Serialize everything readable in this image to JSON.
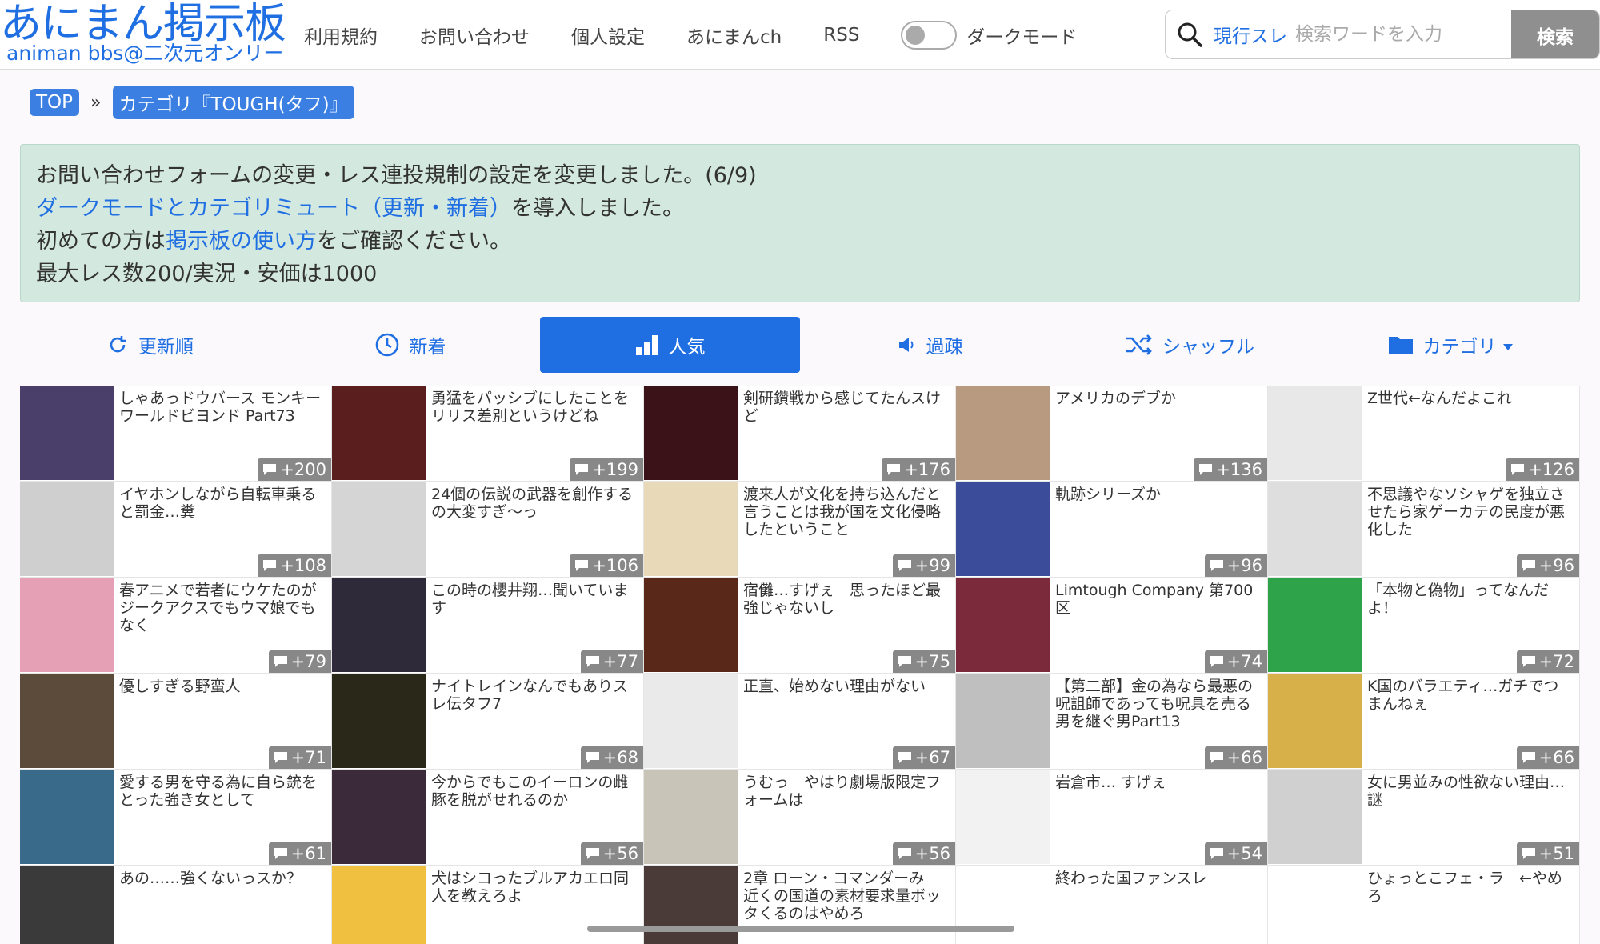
{
  "site": {
    "logo_main": "あにまん掲示板",
    "logo_sub": "animan bbs@二次元オンリー"
  },
  "nav": [
    "利用規約",
    "お問い合わせ",
    "個人設定",
    "あにまんch",
    "RSS"
  ],
  "dark_mode_label": "ダークモード",
  "search": {
    "scope": "現行スレ",
    "placeholder": "検索ワードを入力",
    "button": "検索"
  },
  "breadcrumb": {
    "top": "TOP",
    "sep": "»",
    "category": "カテゴリ『TOUGH(タフ)』"
  },
  "notice": {
    "line1": "お問い合わせフォームの変更・レス連投規制の設定を変更しました。(6/9)",
    "line2_link": "ダークモードとカテゴリミュート（更新・新着）",
    "line2_rest": "を導入しました。",
    "line3_pre": "初めての方は",
    "line3_link": "掲示板の使い方",
    "line3_post": "をご確認ください。",
    "line4": "最大レス数200/実況・安価は1000"
  },
  "tabs": [
    {
      "label": "更新順",
      "icon": "refresh-icon"
    },
    {
      "label": "新着",
      "icon": "clock-icon"
    },
    {
      "label": "人気",
      "icon": "bar-chart-icon",
      "active": true
    },
    {
      "label": "過疎",
      "icon": "speaker-icon"
    },
    {
      "label": "シャッフル",
      "icon": "shuffle-icon"
    },
    {
      "label": "カテゴリ",
      "icon": "folder-icon"
    }
  ],
  "threads": [
    {
      "title": "しゃあっドウバース モンキーワールドビヨンド Part73",
      "count": "+200",
      "color": "#4a3f6b"
    },
    {
      "title": "勇猛をパッシブにしたことをリリス差別というけどね",
      "count": "+199",
      "color": "#5a1e1e"
    },
    {
      "title": "剣研鑽戦から感じてたんスけど",
      "count": "+176",
      "color": "#3a1218"
    },
    {
      "title": "アメリカのデブか",
      "count": "+136",
      "color": "#b89a80"
    },
    {
      "title": "Z世代←なんだよこれ",
      "count": "+126",
      "color": "#e8e8e8"
    },
    {
      "title": "イヤホンしながら自転車乗ると罰金…糞",
      "count": "+108",
      "color": "#cfcfcf"
    },
    {
      "title": "24個の伝説の武器を創作するの大変すぎ〜っ",
      "count": "+106",
      "color": "#d5d5d5"
    },
    {
      "title": "渡来人が文化を持ち込んだと言うことは我が国を文化侵略したということ",
      "count": "+99",
      "color": "#e8d9b8"
    },
    {
      "title": "軌跡シリーズか",
      "count": "+96",
      "color": "#3b4d9a"
    },
    {
      "title": "不思議やなソシャゲを独立させたら家ゲーカテの民度が悪化した",
      "count": "+96",
      "color": "#dedede"
    },
    {
      "title": "春アニメで若者にウケたのがジークアクスでもウマ娘でもなく",
      "count": "+79",
      "color": "#e5a0b5"
    },
    {
      "title": "この時の櫻井翔…聞いています",
      "count": "+77",
      "color": "#2e2a3a"
    },
    {
      "title": "宿儺…すげぇ　思ったほど最強じゃないし",
      "count": "+75",
      "color": "#5a2818"
    },
    {
      "title": "Limtough Company 第700区",
      "count": "+74",
      "color": "#7a2a3a"
    },
    {
      "title": "「本物と偽物」ってなんだよ！",
      "count": "+72",
      "color": "#2fa34a"
    },
    {
      "title": "優しすぎる野蛮人",
      "count": "+71",
      "color": "#5c4a3a"
    },
    {
      "title": "ナイトレインなんでもありスレ伝タフ7",
      "count": "+68",
      "color": "#2a2818"
    },
    {
      "title": "正直、始めない理由がない",
      "count": "+67",
      "color": "#eaeaea"
    },
    {
      "title": "【第二部】金の為なら最悪の呪詛師であっても呪具を売る男を継ぐ男Part13",
      "count": "+66",
      "color": "#bfbfbf"
    },
    {
      "title": "K国のバラエティ…ガチでつまんねぇ",
      "count": "+66",
      "color": "#d8b04a"
    },
    {
      "title": "愛する男を守る為に自ら銃をとった強き女として",
      "count": "+61",
      "color": "#3a6a8a"
    },
    {
      "title": "今からでもこのイーロンの雌豚を脱がせれるのか",
      "count": "+56",
      "color": "#3a2a3a"
    },
    {
      "title": "うむっ　やはり劇場版限定フォームは",
      "count": "+56",
      "color": "#c9c4b8"
    },
    {
      "title": "岩倉市… すげぇ",
      "count": "+54",
      "color": "#f2f2f2"
    },
    {
      "title": "女に男並みの性欲ない理由…謎",
      "count": "+51",
      "color": "#d0d0d0"
    },
    {
      "title": "あの……強くないっスか？",
      "count": "",
      "color": "#3a3a3a"
    },
    {
      "title": "犬はシコったブルアカエロ同人を教えろよ",
      "count": "",
      "color": "#f0c040"
    },
    {
      "title": "2章 ローン・コマンダーみ　近くの国道の素材要求量ボッタくるのはやめろ",
      "count": "",
      "color": "#4a3a38"
    },
    {
      "title": "終わった国ファンスレ",
      "count": "",
      "color": "#ffffff"
    },
    {
      "title": "ひょっとこフェ・ラ　←やめろ",
      "count": "",
      "color": "#ffffff"
    }
  ]
}
